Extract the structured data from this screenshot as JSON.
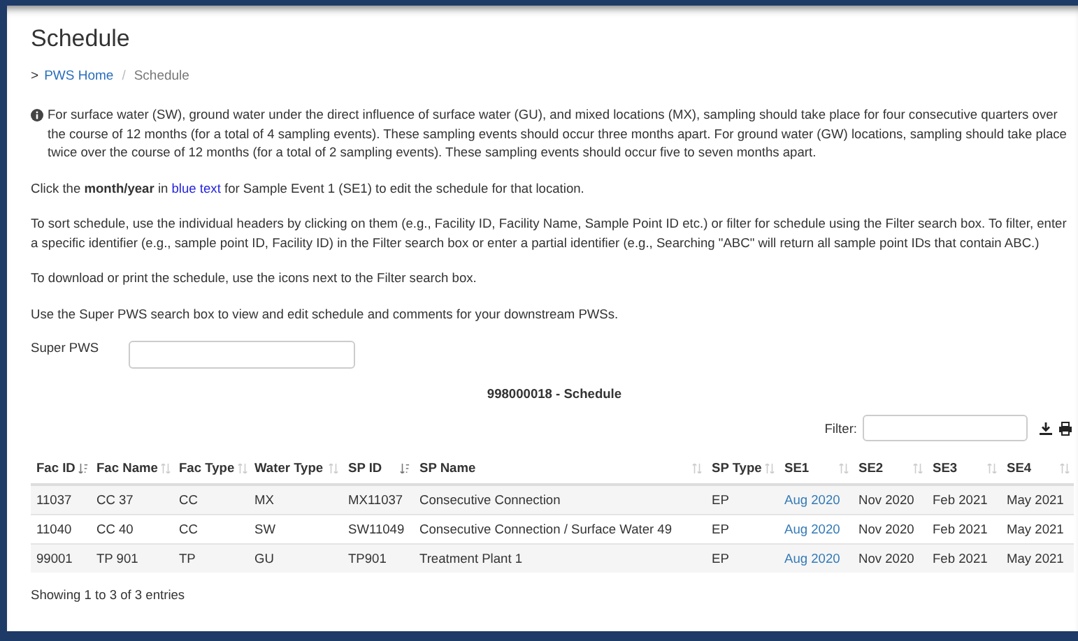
{
  "page": {
    "title": "Schedule"
  },
  "breadcrumb": {
    "separator_marker": ">",
    "items": [
      {
        "label": "PWS Home",
        "kind": "link"
      },
      {
        "label": "Schedule",
        "kind": "current"
      }
    ],
    "divider": "/"
  },
  "info_paragraph": "For surface water (SW), ground water under the direct influence of surface water (GU), and mixed locations (MX), sampling should take place for four consecutive quarters over the course of 12 months (for a total of 4 sampling events). These sampling events should occur three months apart. For ground water (GW) locations, sampling should take place twice over the course of 12 months (for a total of 2 sampling events). These sampling events should occur five to seven months apart.",
  "instructions": [
    [
      {
        "kind": "plain",
        "text": "Click the "
      },
      {
        "kind": "bold",
        "text": "month/year"
      },
      {
        "kind": "plain",
        "text": " in "
      },
      {
        "kind": "blue",
        "text": "blue text"
      },
      {
        "kind": "plain",
        "text": " for Sample Event 1 (SE1) to edit the schedule for that location."
      }
    ],
    [
      {
        "kind": "plain",
        "text": "To sort schedule, use the individual headers by clicking on them (e.g., Facility ID, Facility Name, Sample Point ID etc.) or filter for schedule using the Filter search box. To filter, enter a specific identifier (e.g., sample point ID, Facility ID) in the Filter search box or enter a partial identifier (e.g., Searching \"ABC\" will return all sample point IDs that contain ABC.)"
      }
    ],
    [
      {
        "kind": "plain",
        "text": "To download or print the schedule, use the icons next to the Filter search box."
      }
    ],
    [
      {
        "kind": "plain",
        "text": "Use the Super PWS search box to view and edit schedule and comments for your downstream PWSs."
      }
    ]
  ],
  "super_pws": {
    "label": "Super PWS"
  },
  "table_title": "998000018 - Schedule",
  "filter": {
    "label": "Filter:"
  },
  "table": {
    "columns": [
      {
        "label": "Fac ID",
        "sorted": true,
        "linked": false
      },
      {
        "label": "Fac Name",
        "sorted": false,
        "linked": false
      },
      {
        "label": "Fac Type",
        "sorted": false,
        "linked": false
      },
      {
        "label": "Water Type",
        "sorted": false,
        "linked": false
      },
      {
        "label": "SP ID",
        "sorted": true,
        "linked": false
      },
      {
        "label": "SP Name",
        "sorted": false,
        "linked": false
      },
      {
        "label": "SP Type",
        "sorted": false,
        "linked": false
      },
      {
        "label": "SE1",
        "sorted": false,
        "linked": true
      },
      {
        "label": "SE2",
        "sorted": false,
        "linked": false
      },
      {
        "label": "SE3",
        "sorted": false,
        "linked": false
      },
      {
        "label": "SE4",
        "sorted": false,
        "linked": false
      }
    ],
    "rows": [
      [
        "11037",
        "CC 37",
        "CC",
        "MX",
        "MX11037",
        "Consecutive Connection",
        "EP",
        "Aug 2020",
        "Nov 2020",
        "Feb 2021",
        "May 2021"
      ],
      [
        "11040",
        "CC 40",
        "CC",
        "SW",
        "SW11049",
        "Consecutive Connection / Surface Water 49",
        "EP",
        "Aug 2020",
        "Nov 2020",
        "Feb 2021",
        "May 2021"
      ],
      [
        "99001",
        "TP 901",
        "TP",
        "GU",
        "TP901",
        "Treatment Plant 1",
        "EP",
        "Aug 2020",
        "Nov 2020",
        "Feb 2021",
        "May 2021"
      ]
    ]
  },
  "footer": "Showing 1 to 3 of 3 entries"
}
